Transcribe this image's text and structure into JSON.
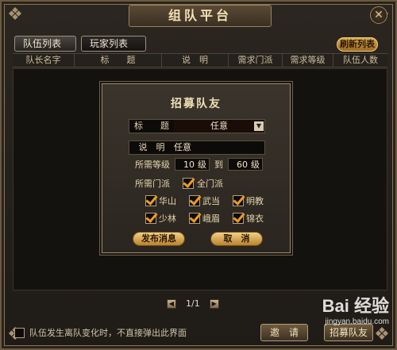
{
  "window": {
    "title": "组队平台",
    "close_glyph": "✕"
  },
  "tabs": [
    {
      "label": "队伍列表"
    },
    {
      "label": "玩家列表"
    }
  ],
  "refresh_button": "刷新列表",
  "columns": [
    {
      "label": "队长名字"
    },
    {
      "label": "标　　题"
    },
    {
      "label": "说　明"
    },
    {
      "label": "需求门派"
    },
    {
      "label": "需求等级"
    },
    {
      "label": "队伍人数"
    }
  ],
  "dialog": {
    "title": "招募队友",
    "title_field": {
      "label": "标　　题",
      "value": "任意"
    },
    "desc_field": {
      "label": "说　明",
      "value": "任意"
    },
    "level": {
      "label": "所需等级",
      "min": "10",
      "unit": "级",
      "to": "到",
      "max": "60"
    },
    "sect": {
      "label": "所需门派",
      "all_label": "全门派",
      "all_checked": true,
      "options": [
        {
          "label": "华山",
          "checked": true
        },
        {
          "label": "武当",
          "checked": true
        },
        {
          "label": "明教",
          "checked": true
        },
        {
          "label": "少林",
          "checked": true
        },
        {
          "label": "峨眉",
          "checked": true
        },
        {
          "label": "锦衣",
          "checked": true
        }
      ]
    },
    "publish_button": "发布消息",
    "cancel_button": "取　消"
  },
  "pager": {
    "text": "1/1",
    "prev_glyph": "◀",
    "next_glyph": "▶"
  },
  "footer": {
    "checkbox_label": "队伍发生离队变化时，不直接弹出此界面",
    "checkbox_checked": false,
    "invite_button": "邀　请",
    "recruit_button": "招募队友"
  },
  "watermark": {
    "main": "Bai 经验",
    "sub": "jingyan.baidu.com"
  },
  "colors": {
    "accent_gold": "#d8a950",
    "checkmark": "#f09a1e",
    "frame": "#6b5a40"
  }
}
